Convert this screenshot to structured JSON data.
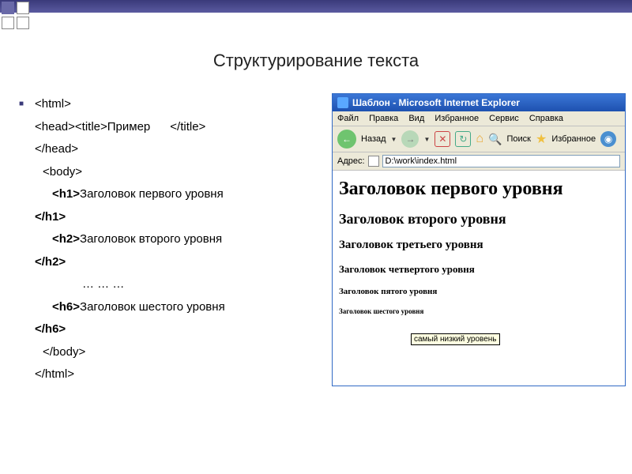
{
  "slide": {
    "title": "Структурирование текста"
  },
  "code": {
    "l1": "<html>",
    "l2a": "<head><title>Пример",
    "l2b": "</title>",
    "l3": "</head>",
    "l4": "<body>",
    "h1o": "<h1>",
    "h1t": "Заголовок первого уровня",
    "h1c": "</h1>",
    "h2o": "<h2>",
    "h2t": "Заголовок второго уровня",
    "h2c": "</h2>",
    "ellipsis": "… … …",
    "h6o": "<h6>",
    "h6t": "Заголовок шестого уровня",
    "h6c": "</h6>",
    "l5": "</body>",
    "l6": "</html>"
  },
  "ie": {
    "title": "Шаблон - Microsoft Internet Explorer",
    "menu": {
      "file": "Файл",
      "edit": "Правка",
      "view": "Вид",
      "favorites": "Избранное",
      "tools": "Сервис",
      "help": "Справка"
    },
    "toolbar": {
      "back": "Назад",
      "search": "Поиск",
      "favorites": "Избранное"
    },
    "address_label": "Адрес:",
    "address_value": "D:\\work\\index.html",
    "headings": {
      "h1": "Заголовок первого уровня",
      "h2": "Заголовок второго уровня",
      "h3": "Заголовок третьего уровня",
      "h4": "Заголовок четвертого уровня",
      "h5": "Заголовок пятого уровня",
      "h6": "Заголовок шестого уровня"
    },
    "tooltip": "самый низкий уровень"
  }
}
